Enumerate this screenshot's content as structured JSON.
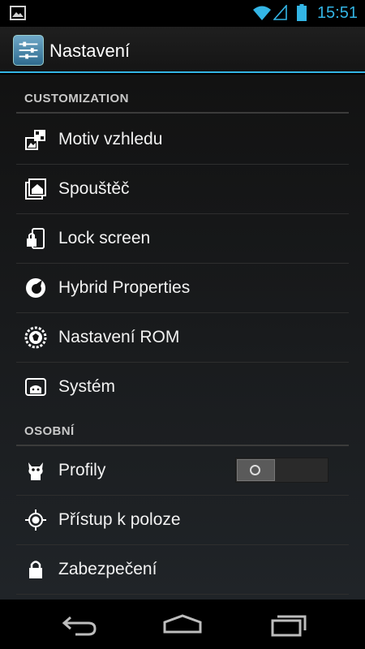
{
  "status_bar": {
    "time": "15:51",
    "icons": [
      "gallery-icon",
      "wifi-icon",
      "signal-icon",
      "battery-icon"
    ],
    "accent_color": "#33b5e5"
  },
  "action_bar": {
    "title": "Nastavení",
    "icon": "settings-sliders-icon"
  },
  "sections": {
    "customization": {
      "header": "CUSTOMIZATION",
      "items": [
        {
          "label": "Motiv vzhledu",
          "icon": "theme-icon"
        },
        {
          "label": "Spouštěč",
          "icon": "launcher-icon"
        },
        {
          "label": "Lock screen",
          "icon": "lock-screen-icon"
        },
        {
          "label": "Hybrid Properties",
          "icon": "hybrid-icon"
        },
        {
          "label": "Nastavení ROM",
          "icon": "rom-settings-icon"
        },
        {
          "label": "Systém",
          "icon": "system-icon"
        }
      ]
    },
    "personal": {
      "header": "OSOBNÍ",
      "items": [
        {
          "label": "Profily",
          "icon": "profiles-icon",
          "toggle": "off"
        },
        {
          "label": "Přístup k poloze",
          "icon": "location-icon"
        },
        {
          "label": "Zabezpečení",
          "icon": "lock-icon"
        }
      ]
    }
  },
  "nav_bar": {
    "buttons": [
      "back-icon",
      "home-icon",
      "recents-icon"
    ]
  }
}
